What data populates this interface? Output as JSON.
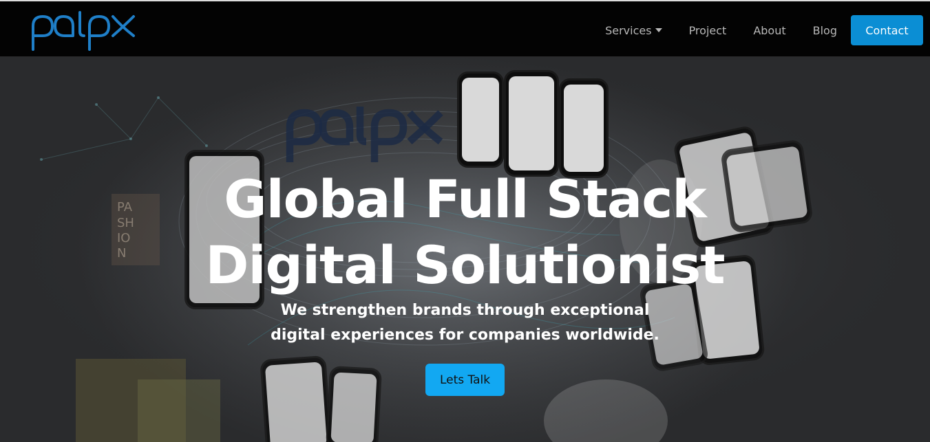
{
  "brand": {
    "logo_text": "palpx",
    "logo_color": "#1f7fc8"
  },
  "nav": {
    "items": [
      {
        "label": "Services",
        "has_dropdown": true
      },
      {
        "label": "Project"
      },
      {
        "label": "About"
      },
      {
        "label": "Blog"
      }
    ],
    "contact_label": "Contact",
    "contact_color": "#0b8ed4"
  },
  "hero": {
    "title_line1": "Global Full Stack",
    "title_line2": "Digital Solutionist",
    "subtitle_line1": "We strengthen brands through exceptional",
    "subtitle_line2": "digital experiences for companies worldwide.",
    "cta_label": "Lets Talk",
    "cta_color": "#12a8f2",
    "background_art": {
      "watermark_text": "palpx",
      "poster_text": [
        "PA",
        "SH",
        "IO",
        "N"
      ]
    }
  }
}
